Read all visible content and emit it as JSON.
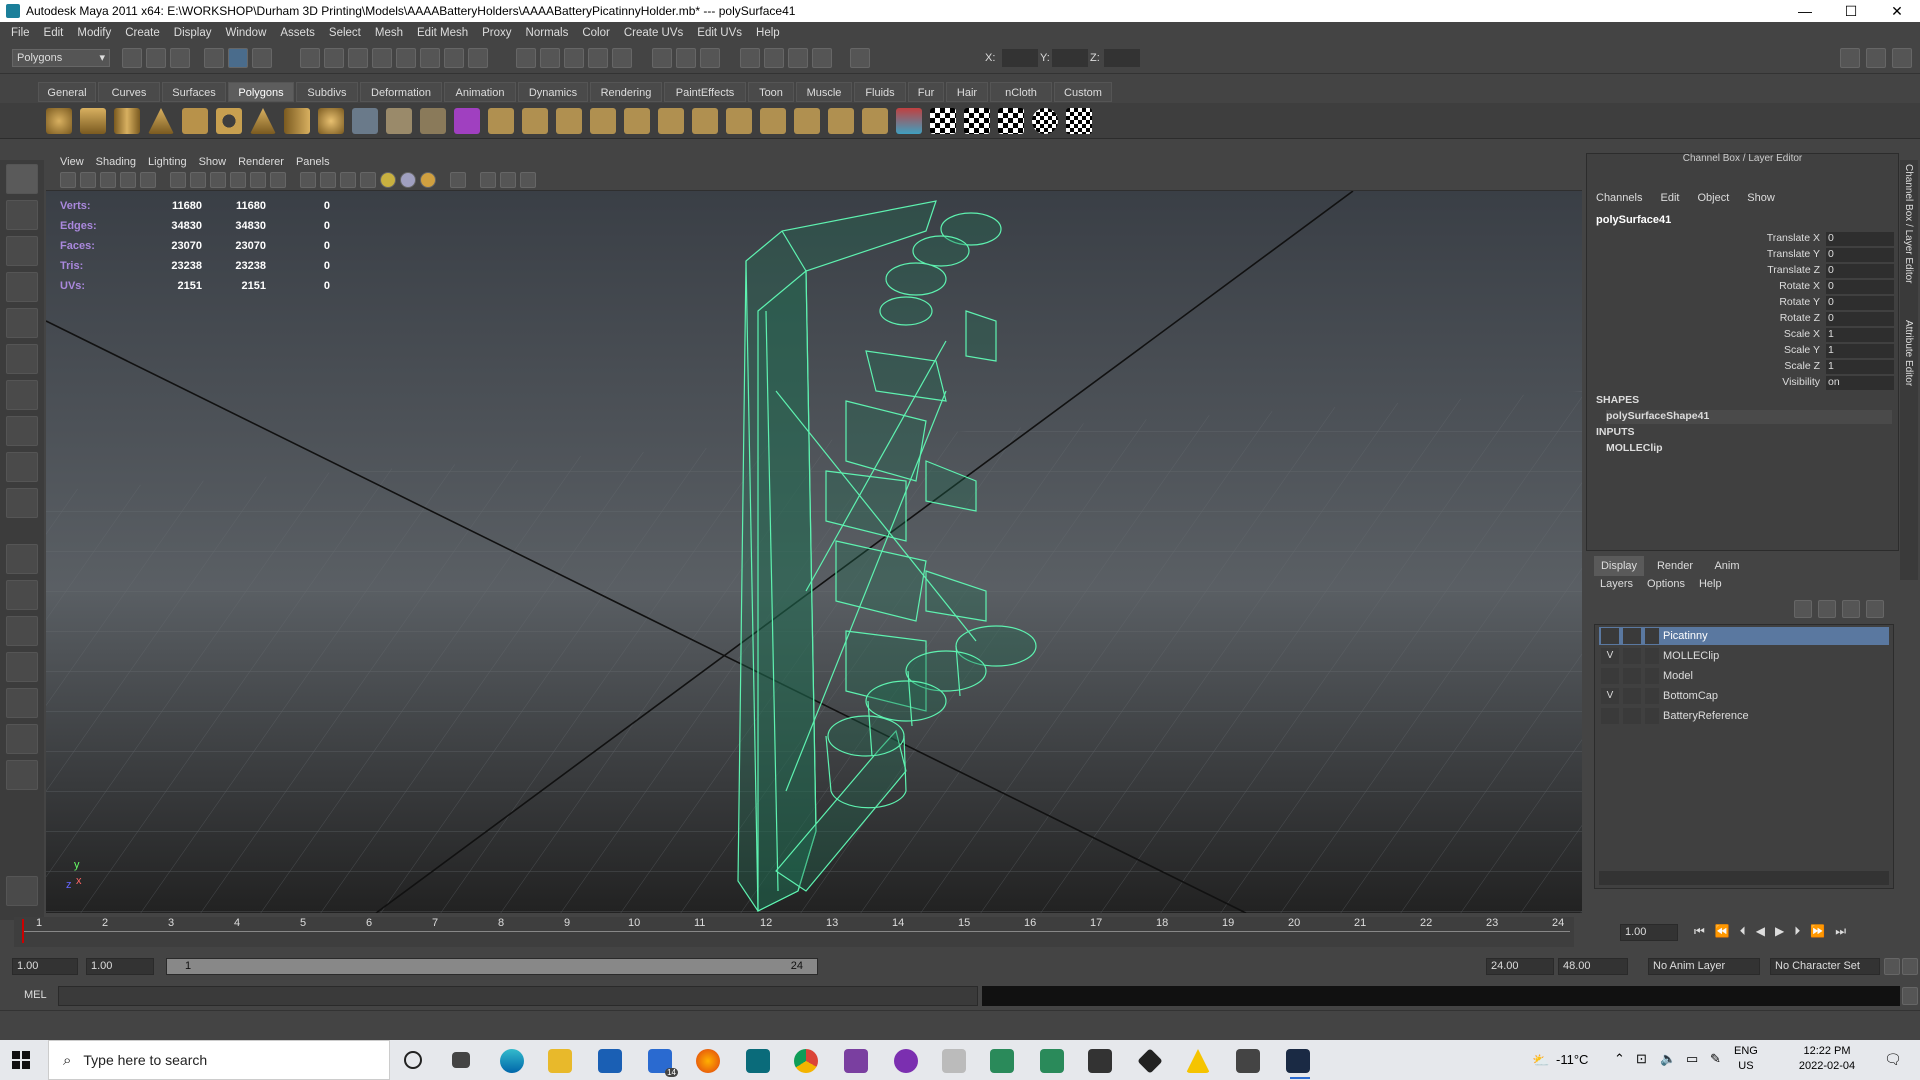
{
  "window": {
    "title": "Autodesk Maya 2011 x64: E:\\WORKSHOP\\Durham 3D Printing\\Models\\AAAABatteryHolders\\AAAABatteryPicatinnyHolder.mb*   ---   polySurface41",
    "minimize": "—",
    "maximize": "☐",
    "close": "✕"
  },
  "menubar": [
    "File",
    "Edit",
    "Modify",
    "Create",
    "Display",
    "Window",
    "Assets",
    "Select",
    "Mesh",
    "Edit Mesh",
    "Proxy",
    "Normals",
    "Color",
    "Create UVs",
    "Edit UVs",
    "Help"
  ],
  "statusline": {
    "mode": "Polygons",
    "x_label": "X:",
    "y_label": "Y:",
    "z_label": "Z:"
  },
  "shelf_tabs": [
    "General",
    "Curves",
    "Surfaces",
    "Polygons",
    "Subdivs",
    "Deformation",
    "Animation",
    "Dynamics",
    "Rendering",
    "PaintEffects",
    "Toon",
    "Muscle",
    "Fluids",
    "Fur",
    "Hair",
    "nCloth",
    "Custom"
  ],
  "shelf_active_tab": "Polygons",
  "panel_menu": [
    "View",
    "Shading",
    "Lighting",
    "Show",
    "Renderer",
    "Panels"
  ],
  "hud": [
    {
      "label": "Verts:",
      "a": "11680",
      "b": "11680",
      "c": "0"
    },
    {
      "label": "Edges:",
      "a": "34830",
      "b": "34830",
      "c": "0"
    },
    {
      "label": "Faces:",
      "a": "23070",
      "b": "23070",
      "c": "0"
    },
    {
      "label": "Tris:",
      "a": "23238",
      "b": "23238",
      "c": "0"
    },
    {
      "label": "UVs:",
      "a": "2151",
      "b": "2151",
      "c": "0"
    }
  ],
  "axis": {
    "y": "y",
    "x": "x",
    "z": "z"
  },
  "channel_box": {
    "title": "Channel Box / Layer Editor",
    "menu": [
      "Channels",
      "Edit",
      "Object",
      "Show"
    ],
    "object": "polySurface41",
    "attributes": [
      {
        "name": "Translate X",
        "value": "0"
      },
      {
        "name": "Translate Y",
        "value": "0"
      },
      {
        "name": "Translate Z",
        "value": "0"
      },
      {
        "name": "Rotate X",
        "value": "0"
      },
      {
        "name": "Rotate Y",
        "value": "0"
      },
      {
        "name": "Rotate Z",
        "value": "0"
      },
      {
        "name": "Scale X",
        "value": "1"
      },
      {
        "name": "Scale Y",
        "value": "1"
      },
      {
        "name": "Scale Z",
        "value": "1"
      },
      {
        "name": "Visibility",
        "value": "on"
      }
    ],
    "shapes_header": "SHAPES",
    "shape": "polySurfaceShape41",
    "inputs_header": "INPUTS",
    "input": "MOLLEClip",
    "side_tabs": [
      "Channel Box / Layer Editor",
      "Attribute Editor"
    ]
  },
  "layer_editor": {
    "tabs": [
      "Display",
      "Render",
      "Anim"
    ],
    "menu": [
      "Layers",
      "Options",
      "Help"
    ],
    "layers": [
      {
        "name": "Picatinny",
        "visible": "",
        "selected": true
      },
      {
        "name": "MOLLEClip",
        "visible": "V",
        "selected": false
      },
      {
        "name": "Model",
        "visible": "",
        "selected": false
      },
      {
        "name": "BottomCap",
        "visible": "V",
        "selected": false
      },
      {
        "name": "BatteryReference",
        "visible": "",
        "selected": false
      }
    ]
  },
  "timeline": {
    "ticks": [
      "1",
      "2",
      "3",
      "4",
      "5",
      "6",
      "7",
      "8",
      "9",
      "10",
      "11",
      "12",
      "13",
      "14",
      "15",
      "16",
      "17",
      "18",
      "19",
      "20",
      "21",
      "22",
      "23",
      "24"
    ],
    "current_time": "1.00"
  },
  "range": {
    "start": "1.00",
    "playback_start": "1.00",
    "slider_start": "1",
    "slider_end": "24",
    "playback_end": "24.00",
    "end": "48.00",
    "anim_layer": "No Anim Layer",
    "char_set": "No Character Set"
  },
  "cmdline": {
    "label": "MEL"
  },
  "taskbar": {
    "search_placeholder": "Type here to search",
    "mail_badge": "14",
    "temperature": "-11°C",
    "lang1": "ENG",
    "lang2": "US",
    "time": "12:22 PM",
    "date": "2022-02-04"
  }
}
